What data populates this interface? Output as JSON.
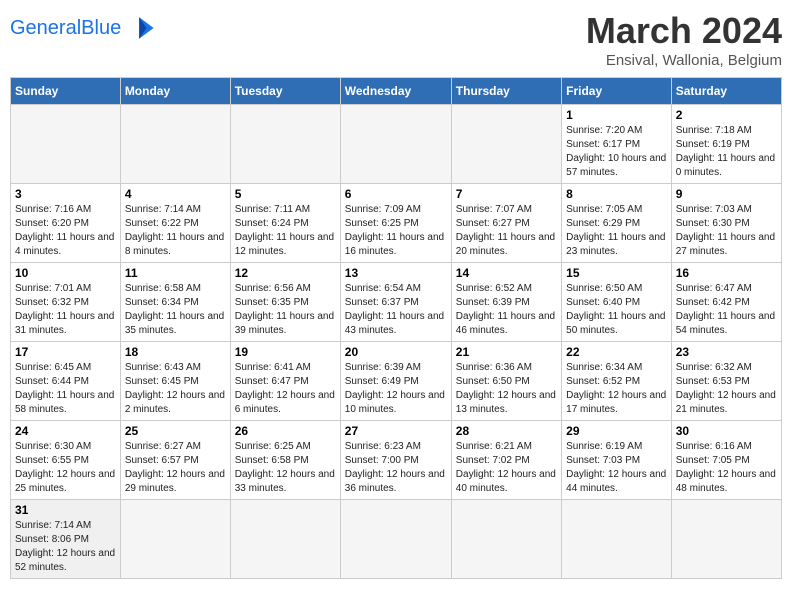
{
  "header": {
    "logo_general": "General",
    "logo_blue": "Blue",
    "month_title": "March 2024",
    "subtitle": "Ensival, Wallonia, Belgium"
  },
  "days_of_week": [
    "Sunday",
    "Monday",
    "Tuesday",
    "Wednesday",
    "Thursday",
    "Friday",
    "Saturday"
  ],
  "weeks": [
    [
      {
        "day": "",
        "info": ""
      },
      {
        "day": "",
        "info": ""
      },
      {
        "day": "",
        "info": ""
      },
      {
        "day": "",
        "info": ""
      },
      {
        "day": "",
        "info": ""
      },
      {
        "day": "1",
        "info": "Sunrise: 7:20 AM\nSunset: 6:17 PM\nDaylight: 10 hours and 57 minutes."
      },
      {
        "day": "2",
        "info": "Sunrise: 7:18 AM\nSunset: 6:19 PM\nDaylight: 11 hours and 0 minutes."
      }
    ],
    [
      {
        "day": "3",
        "info": "Sunrise: 7:16 AM\nSunset: 6:20 PM\nDaylight: 11 hours and 4 minutes."
      },
      {
        "day": "4",
        "info": "Sunrise: 7:14 AM\nSunset: 6:22 PM\nDaylight: 11 hours and 8 minutes."
      },
      {
        "day": "5",
        "info": "Sunrise: 7:11 AM\nSunset: 6:24 PM\nDaylight: 11 hours and 12 minutes."
      },
      {
        "day": "6",
        "info": "Sunrise: 7:09 AM\nSunset: 6:25 PM\nDaylight: 11 hours and 16 minutes."
      },
      {
        "day": "7",
        "info": "Sunrise: 7:07 AM\nSunset: 6:27 PM\nDaylight: 11 hours and 20 minutes."
      },
      {
        "day": "8",
        "info": "Sunrise: 7:05 AM\nSunset: 6:29 PM\nDaylight: 11 hours and 23 minutes."
      },
      {
        "day": "9",
        "info": "Sunrise: 7:03 AM\nSunset: 6:30 PM\nDaylight: 11 hours and 27 minutes."
      }
    ],
    [
      {
        "day": "10",
        "info": "Sunrise: 7:01 AM\nSunset: 6:32 PM\nDaylight: 11 hours and 31 minutes."
      },
      {
        "day": "11",
        "info": "Sunrise: 6:58 AM\nSunset: 6:34 PM\nDaylight: 11 hours and 35 minutes."
      },
      {
        "day": "12",
        "info": "Sunrise: 6:56 AM\nSunset: 6:35 PM\nDaylight: 11 hours and 39 minutes."
      },
      {
        "day": "13",
        "info": "Sunrise: 6:54 AM\nSunset: 6:37 PM\nDaylight: 11 hours and 43 minutes."
      },
      {
        "day": "14",
        "info": "Sunrise: 6:52 AM\nSunset: 6:39 PM\nDaylight: 11 hours and 46 minutes."
      },
      {
        "day": "15",
        "info": "Sunrise: 6:50 AM\nSunset: 6:40 PM\nDaylight: 11 hours and 50 minutes."
      },
      {
        "day": "16",
        "info": "Sunrise: 6:47 AM\nSunset: 6:42 PM\nDaylight: 11 hours and 54 minutes."
      }
    ],
    [
      {
        "day": "17",
        "info": "Sunrise: 6:45 AM\nSunset: 6:44 PM\nDaylight: 11 hours and 58 minutes."
      },
      {
        "day": "18",
        "info": "Sunrise: 6:43 AM\nSunset: 6:45 PM\nDaylight: 12 hours and 2 minutes."
      },
      {
        "day": "19",
        "info": "Sunrise: 6:41 AM\nSunset: 6:47 PM\nDaylight: 12 hours and 6 minutes."
      },
      {
        "day": "20",
        "info": "Sunrise: 6:39 AM\nSunset: 6:49 PM\nDaylight: 12 hours and 10 minutes."
      },
      {
        "day": "21",
        "info": "Sunrise: 6:36 AM\nSunset: 6:50 PM\nDaylight: 12 hours and 13 minutes."
      },
      {
        "day": "22",
        "info": "Sunrise: 6:34 AM\nSunset: 6:52 PM\nDaylight: 12 hours and 17 minutes."
      },
      {
        "day": "23",
        "info": "Sunrise: 6:32 AM\nSunset: 6:53 PM\nDaylight: 12 hours and 21 minutes."
      }
    ],
    [
      {
        "day": "24",
        "info": "Sunrise: 6:30 AM\nSunset: 6:55 PM\nDaylight: 12 hours and 25 minutes."
      },
      {
        "day": "25",
        "info": "Sunrise: 6:27 AM\nSunset: 6:57 PM\nDaylight: 12 hours and 29 minutes."
      },
      {
        "day": "26",
        "info": "Sunrise: 6:25 AM\nSunset: 6:58 PM\nDaylight: 12 hours and 33 minutes."
      },
      {
        "day": "27",
        "info": "Sunrise: 6:23 AM\nSunset: 7:00 PM\nDaylight: 12 hours and 36 minutes."
      },
      {
        "day": "28",
        "info": "Sunrise: 6:21 AM\nSunset: 7:02 PM\nDaylight: 12 hours and 40 minutes."
      },
      {
        "day": "29",
        "info": "Sunrise: 6:19 AM\nSunset: 7:03 PM\nDaylight: 12 hours and 44 minutes."
      },
      {
        "day": "30",
        "info": "Sunrise: 6:16 AM\nSunset: 7:05 PM\nDaylight: 12 hours and 48 minutes."
      }
    ],
    [
      {
        "day": "31",
        "info": "Sunrise: 7:14 AM\nSunset: 8:06 PM\nDaylight: 12 hours and 52 minutes."
      },
      {
        "day": "",
        "info": ""
      },
      {
        "day": "",
        "info": ""
      },
      {
        "day": "",
        "info": ""
      },
      {
        "day": "",
        "info": ""
      },
      {
        "day": "",
        "info": ""
      },
      {
        "day": "",
        "info": ""
      }
    ]
  ]
}
